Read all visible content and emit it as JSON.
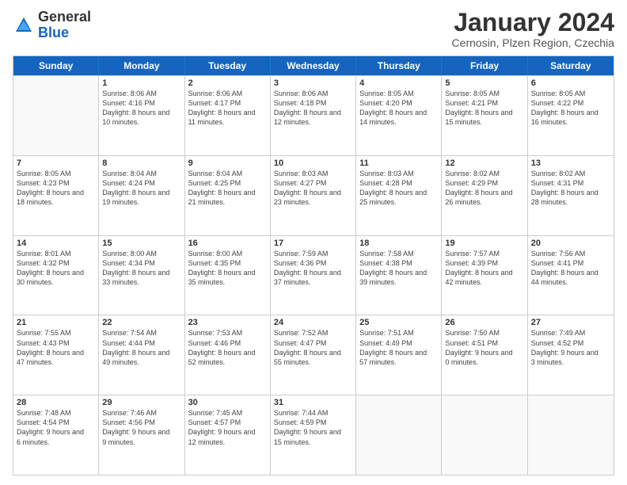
{
  "logo": {
    "general": "General",
    "blue": "Blue"
  },
  "title": "January 2024",
  "subtitle": "Cernosin, Plzen Region, Czechia",
  "days_of_week": [
    "Sunday",
    "Monday",
    "Tuesday",
    "Wednesday",
    "Thursday",
    "Friday",
    "Saturday"
  ],
  "weeks": [
    [
      {
        "day": "",
        "empty": true
      },
      {
        "day": "1",
        "sunrise": "Sunrise: 8:06 AM",
        "sunset": "Sunset: 4:16 PM",
        "daylight": "Daylight: 8 hours and 10 minutes."
      },
      {
        "day": "2",
        "sunrise": "Sunrise: 8:06 AM",
        "sunset": "Sunset: 4:17 PM",
        "daylight": "Daylight: 8 hours and 11 minutes."
      },
      {
        "day": "3",
        "sunrise": "Sunrise: 8:06 AM",
        "sunset": "Sunset: 4:18 PM",
        "daylight": "Daylight: 8 hours and 12 minutes."
      },
      {
        "day": "4",
        "sunrise": "Sunrise: 8:05 AM",
        "sunset": "Sunset: 4:20 PM",
        "daylight": "Daylight: 8 hours and 14 minutes."
      },
      {
        "day": "5",
        "sunrise": "Sunrise: 8:05 AM",
        "sunset": "Sunset: 4:21 PM",
        "daylight": "Daylight: 8 hours and 15 minutes."
      },
      {
        "day": "6",
        "sunrise": "Sunrise: 8:05 AM",
        "sunset": "Sunset: 4:22 PM",
        "daylight": "Daylight: 8 hours and 16 minutes."
      }
    ],
    [
      {
        "day": "7",
        "sunrise": "Sunrise: 8:05 AM",
        "sunset": "Sunset: 4:23 PM",
        "daylight": "Daylight: 8 hours and 18 minutes."
      },
      {
        "day": "8",
        "sunrise": "Sunrise: 8:04 AM",
        "sunset": "Sunset: 4:24 PM",
        "daylight": "Daylight: 8 hours and 19 minutes."
      },
      {
        "day": "9",
        "sunrise": "Sunrise: 8:04 AM",
        "sunset": "Sunset: 4:25 PM",
        "daylight": "Daylight: 8 hours and 21 minutes."
      },
      {
        "day": "10",
        "sunrise": "Sunrise: 8:03 AM",
        "sunset": "Sunset: 4:27 PM",
        "daylight": "Daylight: 8 hours and 23 minutes."
      },
      {
        "day": "11",
        "sunrise": "Sunrise: 8:03 AM",
        "sunset": "Sunset: 4:28 PM",
        "daylight": "Daylight: 8 hours and 25 minutes."
      },
      {
        "day": "12",
        "sunrise": "Sunrise: 8:02 AM",
        "sunset": "Sunset: 4:29 PM",
        "daylight": "Daylight: 8 hours and 26 minutes."
      },
      {
        "day": "13",
        "sunrise": "Sunrise: 8:02 AM",
        "sunset": "Sunset: 4:31 PM",
        "daylight": "Daylight: 8 hours and 28 minutes."
      }
    ],
    [
      {
        "day": "14",
        "sunrise": "Sunrise: 8:01 AM",
        "sunset": "Sunset: 4:32 PM",
        "daylight": "Daylight: 8 hours and 30 minutes."
      },
      {
        "day": "15",
        "sunrise": "Sunrise: 8:00 AM",
        "sunset": "Sunset: 4:34 PM",
        "daylight": "Daylight: 8 hours and 33 minutes."
      },
      {
        "day": "16",
        "sunrise": "Sunrise: 8:00 AM",
        "sunset": "Sunset: 4:35 PM",
        "daylight": "Daylight: 8 hours and 35 minutes."
      },
      {
        "day": "17",
        "sunrise": "Sunrise: 7:59 AM",
        "sunset": "Sunset: 4:36 PM",
        "daylight": "Daylight: 8 hours and 37 minutes."
      },
      {
        "day": "18",
        "sunrise": "Sunrise: 7:58 AM",
        "sunset": "Sunset: 4:38 PM",
        "daylight": "Daylight: 8 hours and 39 minutes."
      },
      {
        "day": "19",
        "sunrise": "Sunrise: 7:57 AM",
        "sunset": "Sunset: 4:39 PM",
        "daylight": "Daylight: 8 hours and 42 minutes."
      },
      {
        "day": "20",
        "sunrise": "Sunrise: 7:56 AM",
        "sunset": "Sunset: 4:41 PM",
        "daylight": "Daylight: 8 hours and 44 minutes."
      }
    ],
    [
      {
        "day": "21",
        "sunrise": "Sunrise: 7:55 AM",
        "sunset": "Sunset: 4:43 PM",
        "daylight": "Daylight: 8 hours and 47 minutes."
      },
      {
        "day": "22",
        "sunrise": "Sunrise: 7:54 AM",
        "sunset": "Sunset: 4:44 PM",
        "daylight": "Daylight: 8 hours and 49 minutes."
      },
      {
        "day": "23",
        "sunrise": "Sunrise: 7:53 AM",
        "sunset": "Sunset: 4:46 PM",
        "daylight": "Daylight: 8 hours and 52 minutes."
      },
      {
        "day": "24",
        "sunrise": "Sunrise: 7:52 AM",
        "sunset": "Sunset: 4:47 PM",
        "daylight": "Daylight: 8 hours and 55 minutes."
      },
      {
        "day": "25",
        "sunrise": "Sunrise: 7:51 AM",
        "sunset": "Sunset: 4:49 PM",
        "daylight": "Daylight: 8 hours and 57 minutes."
      },
      {
        "day": "26",
        "sunrise": "Sunrise: 7:50 AM",
        "sunset": "Sunset: 4:51 PM",
        "daylight": "Daylight: 9 hours and 0 minutes."
      },
      {
        "day": "27",
        "sunrise": "Sunrise: 7:49 AM",
        "sunset": "Sunset: 4:52 PM",
        "daylight": "Daylight: 9 hours and 3 minutes."
      }
    ],
    [
      {
        "day": "28",
        "sunrise": "Sunrise: 7:48 AM",
        "sunset": "Sunset: 4:54 PM",
        "daylight": "Daylight: 9 hours and 6 minutes."
      },
      {
        "day": "29",
        "sunrise": "Sunrise: 7:46 AM",
        "sunset": "Sunset: 4:56 PM",
        "daylight": "Daylight: 9 hours and 9 minutes."
      },
      {
        "day": "30",
        "sunrise": "Sunrise: 7:45 AM",
        "sunset": "Sunset: 4:57 PM",
        "daylight": "Daylight: 9 hours and 12 minutes."
      },
      {
        "day": "31",
        "sunrise": "Sunrise: 7:44 AM",
        "sunset": "Sunset: 4:59 PM",
        "daylight": "Daylight: 9 hours and 15 minutes."
      },
      {
        "day": "",
        "empty": true
      },
      {
        "day": "",
        "empty": true
      },
      {
        "day": "",
        "empty": true
      }
    ]
  ]
}
